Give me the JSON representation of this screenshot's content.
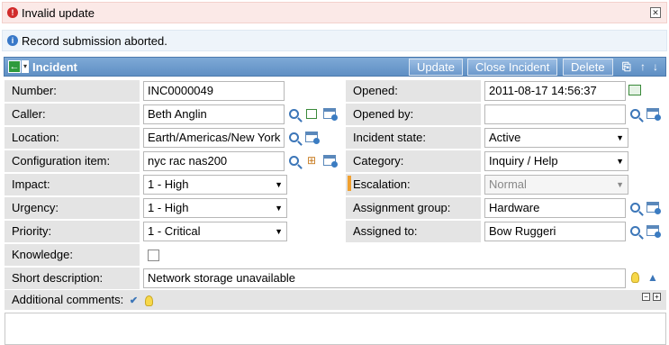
{
  "messages": {
    "error": "Invalid update",
    "info": "Record submission aborted."
  },
  "header": {
    "title": "Incident",
    "buttons": {
      "update": "Update",
      "close": "Close Incident",
      "delete": "Delete"
    }
  },
  "fields": {
    "number": {
      "label": "Number:",
      "value": "INC0000049"
    },
    "caller": {
      "label": "Caller:",
      "value": "Beth Anglin"
    },
    "location": {
      "label": "Location:",
      "value": "Earth/Americas/New York"
    },
    "config_item": {
      "label": "Configuration item:",
      "value": "nyc rac nas200"
    },
    "impact": {
      "label": "Impact:",
      "value": "1 - High"
    },
    "urgency": {
      "label": "Urgency:",
      "value": "1 - High"
    },
    "priority": {
      "label": "Priority:",
      "value": "1 - Critical"
    },
    "knowledge": {
      "label": "Knowledge:",
      "checked": false
    },
    "short_description": {
      "label": "Short description:",
      "value": "Network storage unavailable"
    },
    "opened": {
      "label": "Opened:",
      "value": "2011-08-17 14:56:37"
    },
    "opened_by": {
      "label": "Opened by:",
      "value": ""
    },
    "incident_state": {
      "label": "Incident state:",
      "value": "Active"
    },
    "category": {
      "label": "Category:",
      "value": "Inquiry / Help"
    },
    "escalation": {
      "label": "Escalation:",
      "value": "Normal"
    },
    "assignment_group": {
      "label": "Assignment group:",
      "value": "Hardware"
    },
    "assigned_to": {
      "label": "Assigned to:",
      "value": "Bow Ruggeri"
    }
  },
  "comments": {
    "label": "Additional comments:"
  },
  "colors": {
    "header": "#6b98ca",
    "label_bg": "#e4e4e4",
    "error_bg": "#fbe9e7",
    "info_bg": "#eef4fa",
    "escalation_marker": "#f0a030"
  }
}
